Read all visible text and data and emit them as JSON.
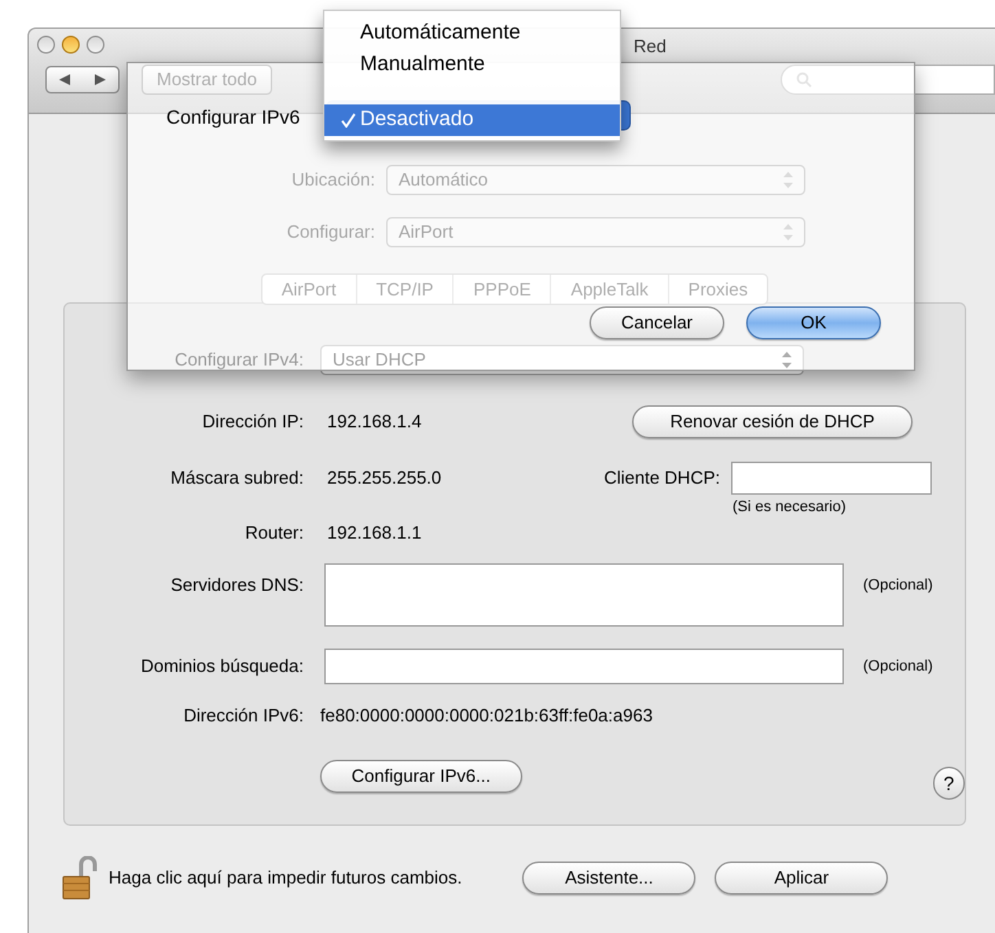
{
  "window": {
    "title": "Red"
  },
  "toolbar": {
    "show_all": "Mostrar todo"
  },
  "location": {
    "label": "Ubicación:",
    "value": "Automático"
  },
  "configure": {
    "label": "Configurar:",
    "value": "AirPort"
  },
  "tabs": [
    {
      "label": "AirPort"
    },
    {
      "label": "TCP/IP"
    },
    {
      "label": "PPPoE"
    },
    {
      "label": "AppleTalk"
    },
    {
      "label": "Proxies"
    }
  ],
  "tcpip": {
    "ipv4_label": "Configurar IPv4:",
    "ipv4_value": "Usar DHCP",
    "ip_label": "Dirección IP:",
    "ip_value": "192.168.1.4",
    "renew_button": "Renovar cesión de DHCP",
    "mask_label": "Máscara subred:",
    "mask_value": "255.255.255.0",
    "client_label": "Cliente DHCP:",
    "client_hint": "(Si es necesario)",
    "router_label": "Router:",
    "router_value": "192.168.1.1",
    "dns_label": "Servidores DNS:",
    "dns_note": "(Opcional)",
    "search_label": "Dominios búsqueda:",
    "search_note": "(Opcional)",
    "ipv6_label": "Dirección IPv6:",
    "ipv6_value": "fe80:0000:0000:0000:021b:63ff:fe0a:a963",
    "ipv6_button": "Configurar IPv6...",
    "help": "?"
  },
  "lock": {
    "locked": false,
    "text": "Haga clic aquí para impedir futuros cambios."
  },
  "buttons": [
    {
      "label": "Asistente..."
    },
    {
      "label": "Aplicar"
    }
  ],
  "sheet": {
    "label": "Configurar IPv6",
    "menu": [
      {
        "label": "Automáticamente",
        "selected": false
      },
      {
        "label": "Manualmente",
        "selected": false
      },
      {
        "label": "Desactivado",
        "selected": true
      }
    ],
    "buttons": [
      {
        "label": "Cancelar",
        "default": false
      },
      {
        "label": "OK",
        "default": true
      }
    ]
  }
}
